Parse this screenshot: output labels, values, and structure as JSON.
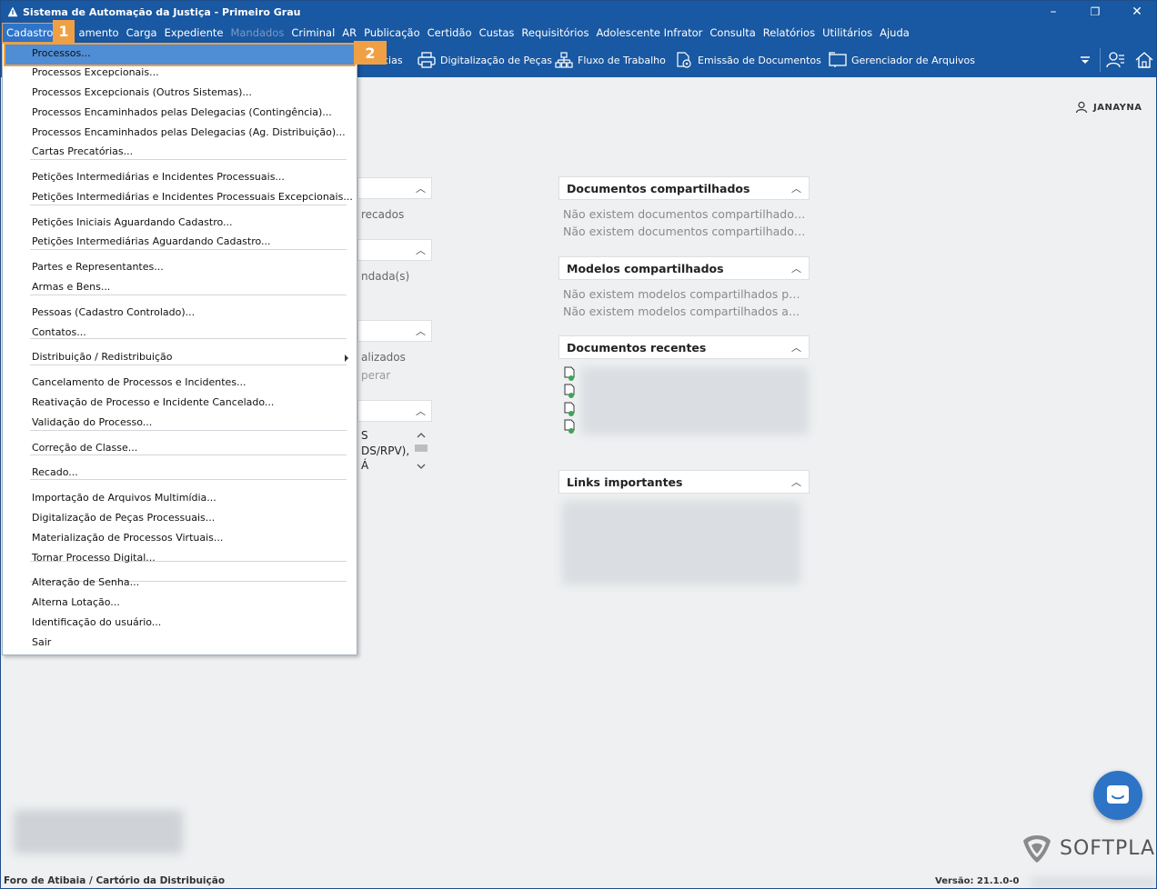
{
  "window": {
    "title": "Sistema de Automação da Justiça - Primeiro Grau",
    "minimize_glyph": "–",
    "maximize_glyph": "❐",
    "close_glyph": "✕"
  },
  "menubar": {
    "items": [
      {
        "label": "Cadastro",
        "state": "active"
      },
      {
        "label": "amento",
        "state": "normal"
      },
      {
        "label": "Carga",
        "state": "normal"
      },
      {
        "label": "Expediente",
        "state": "normal"
      },
      {
        "label": "Mandados",
        "state": "disabled"
      },
      {
        "label": "Criminal",
        "state": "normal"
      },
      {
        "label": "AR",
        "state": "normal"
      },
      {
        "label": "Publicação",
        "state": "normal"
      },
      {
        "label": "Certidão",
        "state": "normal"
      },
      {
        "label": "Custas",
        "state": "normal"
      },
      {
        "label": "Requisitórios",
        "state": "normal"
      },
      {
        "label": "Adolescente Infrator",
        "state": "normal"
      },
      {
        "label": "Consulta",
        "state": "normal"
      },
      {
        "label": "Relatórios",
        "state": "normal"
      },
      {
        "label": "Utilitários",
        "state": "normal"
      },
      {
        "label": "Ajuda",
        "state": "normal"
      }
    ]
  },
  "toolbar": {
    "partial_label": "cias",
    "items": [
      {
        "label": "Digitalização de Peças",
        "icon": "printer-icon"
      },
      {
        "label": "Fluxo de Trabalho",
        "icon": "workflow-icon"
      },
      {
        "label": "Emissão de Documentos",
        "icon": "document-gear-icon"
      },
      {
        "label": "Gerenciador de Arquivos",
        "icon": "file-manager-icon"
      }
    ]
  },
  "user": {
    "name": "JANAYNA"
  },
  "dropdown": {
    "items": [
      {
        "label": "Processos...",
        "highlight": true
      },
      {
        "label": "Processos Excepcionais..."
      },
      {
        "label": "Processos Excepcionais (Outros Sistemas)..."
      },
      {
        "label": "Processos Encaminhados pelas Delegacias (Contingência)..."
      },
      {
        "label": "Processos Encaminhados pelas Delegacias (Ag. Distribuição)..."
      },
      {
        "label": "Cartas Precatórias..."
      },
      {
        "label": "Petições Intermediárias e Incidentes Processuais..."
      },
      {
        "label": "Petições Intermediárias e Incidentes Processuais Excepcionais..."
      },
      {
        "label": "Petições Iniciais Aguardando Cadastro..."
      },
      {
        "label": "Petições Intermediárias Aguardando Cadastro..."
      },
      {
        "label": "Partes e Representantes..."
      },
      {
        "label": "Armas e Bens..."
      },
      {
        "label": "Pessoas (Cadastro Controlado)..."
      },
      {
        "label": "Contatos..."
      },
      {
        "label": "Distribuição / Redistribuição",
        "submenu": true
      },
      {
        "label": "Cancelamento de Processos e Incidentes..."
      },
      {
        "label": "Reativação de Processo e Incidente Cancelado..."
      },
      {
        "label": "Validação do Processo..."
      },
      {
        "label": "Correção de Classe..."
      },
      {
        "label": "Recado..."
      },
      {
        "label": "Importação de Arquivos Multimídia..."
      },
      {
        "label": "Digitalização de Peças Processuais..."
      },
      {
        "label": "Materialização de Processos Virtuais..."
      },
      {
        "label": "Tornar Processo Digital..."
      },
      {
        "label": "Alteração de Senha..."
      },
      {
        "label": "Alterna Lotação..."
      },
      {
        "label": "Identificação do usuário..."
      },
      {
        "label": "Sair"
      }
    ]
  },
  "steps": {
    "one": "1",
    "two": "2"
  },
  "left_fragments": {
    "a": "recados",
    "b": "ndada(s)",
    "c": "alizados",
    "d": "perar",
    "e": "S",
    "f": "DS/RPV),",
    "g": "Á"
  },
  "panels": {
    "shared_docs": {
      "title": "Documentos compartilhados",
      "lines": [
        "Não existem documentos compartilhados ...",
        "Não existem documentos compartilhados ..."
      ]
    },
    "shared_models": {
      "title": "Modelos compartilhados",
      "lines": [
        "Não existem modelos compartilhados pelo...",
        "Não existem modelos compartilhados ao u..."
      ]
    },
    "recent_docs": {
      "title": "Documentos recentes"
    },
    "links": {
      "title": "Links importantes"
    }
  },
  "brand": {
    "name": "SOFTPLAN"
  },
  "status": {
    "left": "Foro de Atibaia / Cartório da Distribuição",
    "version": "Versão: 21.1.0-0"
  },
  "colors": {
    "title_blue": "#1958a2",
    "accent_orange": "#f0a044",
    "highlight_blue": "#4f8dd5"
  }
}
